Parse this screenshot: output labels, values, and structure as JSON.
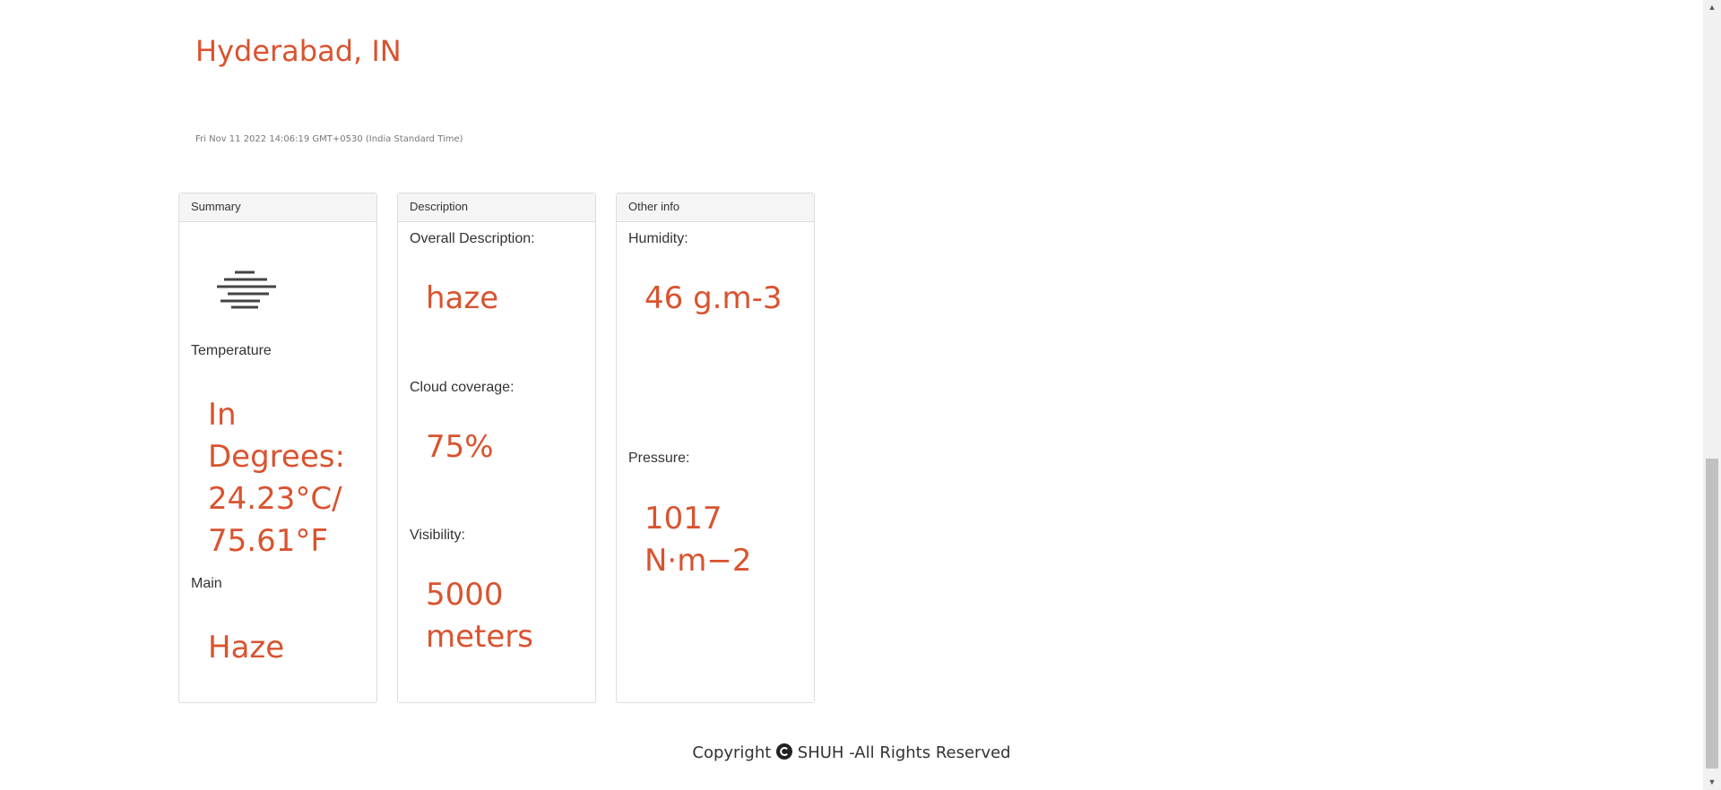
{
  "location": {
    "city": "Hyderabad, IN",
    "datetime": "Fri Nov 11 2022 14:06:19 GMT+0530 (India Standard Time)"
  },
  "summary": {
    "heading": "Summary",
    "weather_icon": "haze-icon",
    "temperature_label": "Temperature",
    "temperature_line1": "In Degrees:",
    "temperature_line2": "24.23°C/",
    "temperature_line3": "75.61°F",
    "main_label": "Main",
    "main_value": "Haze"
  },
  "description": {
    "heading": "Description",
    "overall_label": "Overall Description:",
    "overall_value": "haze",
    "cloud_label": "Cloud coverage:",
    "cloud_value": "75%",
    "visibility_label": "Visibility:",
    "visibility_line1": "5000",
    "visibility_line2": "meters"
  },
  "other_info": {
    "heading": "Other info",
    "humidity_label": "Humidity:",
    "humidity_value": "46 g.m-3",
    "pressure_label": "Pressure:",
    "pressure_line1": "1017",
    "pressure_line2": "N·m−2"
  },
  "footer": {
    "copyright_prefix": "Copyright",
    "copyright_icon": "copyright-icon",
    "copyright_suffix": "SHUH -All Rights Reserved"
  },
  "colors": {
    "accent": "#d9532f",
    "panel_heading_bg": "#f5f5f5",
    "border": "#dddddd"
  }
}
